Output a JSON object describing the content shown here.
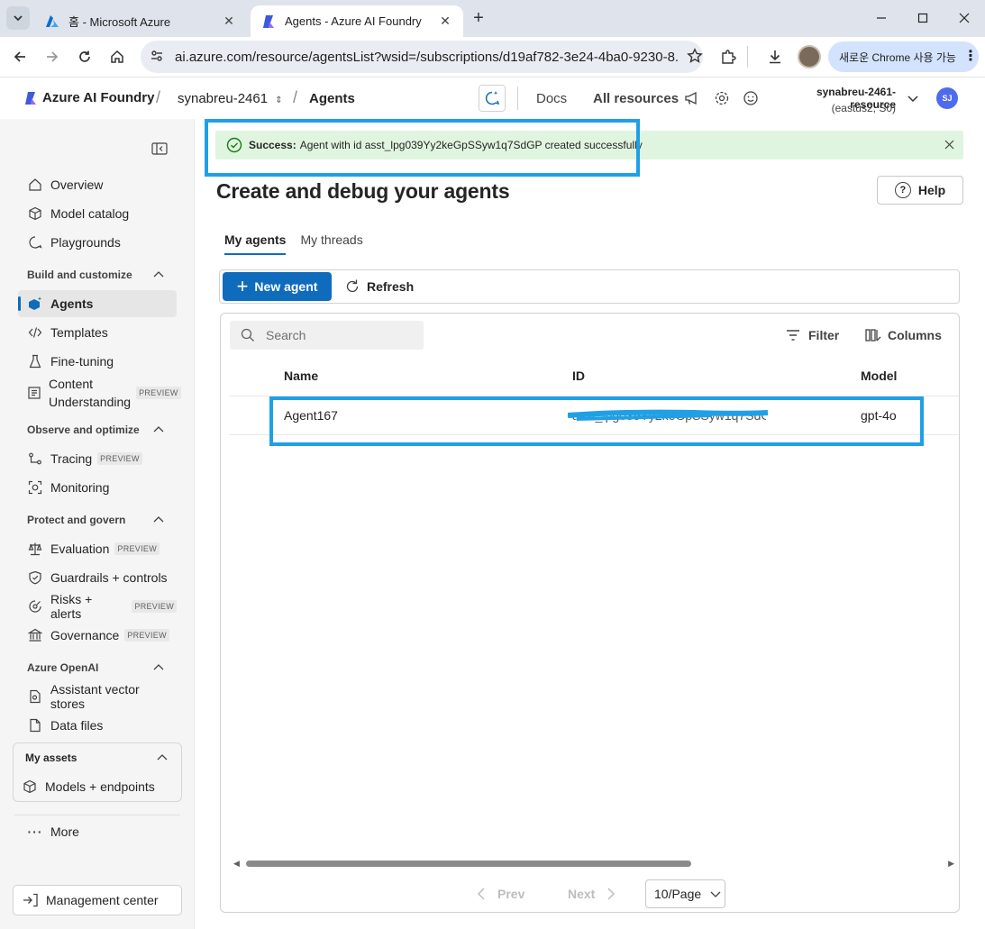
{
  "browser": {
    "tabs": [
      {
        "title": "홈 - Microsoft Azure",
        "active": false
      },
      {
        "title": "Agents - Azure AI Foundry",
        "active": true
      }
    ],
    "url": "ai.azure.com/resource/agentsList?wsid=/subscriptions/d19af782-3e24-4ba0-9230-8...",
    "chrome_available": "새로운 Chrome 사용 가능"
  },
  "header": {
    "brand": "Azure AI Foundry",
    "project": "synabreu-2461",
    "page": "Agents",
    "docs": "Docs",
    "all_resources": "All resources",
    "resource_name": "synabreu-2461-resource",
    "resource_sub": "(eastus2, S0)",
    "avatar_initials": "SJ"
  },
  "sidebar": {
    "top_items": [
      "Overview",
      "Model catalog",
      "Playgrounds"
    ],
    "sections": {
      "build": "Build and customize",
      "observe": "Observe and optimize",
      "protect": "Protect and govern",
      "openai": "Azure OpenAI",
      "assets": "My assets"
    },
    "build_items": [
      "Agents",
      "Templates",
      "Fine-tuning"
    ],
    "content_understanding": [
      "Content",
      "Understanding"
    ],
    "observe_items": [
      "Tracing",
      "Monitoring"
    ],
    "protect_items": [
      "Evaluation",
      "Guardrails + controls",
      "Risks + alerts",
      "Governance"
    ],
    "openai_items": [
      "Assistant vector stores",
      "Data files"
    ],
    "assets_items": [
      "Models + endpoints"
    ],
    "preview_badge": "PREVIEW",
    "more": "More",
    "management_center": "Management center"
  },
  "notification": {
    "label": "Success:",
    "message": "Agent with id asst_lpg039Yy2keGpSSyw1q7SdGP created successfully"
  },
  "main": {
    "title": "Create and debug your agents",
    "help": "Help",
    "tabs": [
      "My agents",
      "My threads"
    ],
    "new_agent": "New agent",
    "refresh": "Refresh",
    "search_placeholder": "Search",
    "filter": "Filter",
    "columns": "Columns",
    "table": {
      "headers": [
        "Name",
        "ID",
        "Model"
      ],
      "rows": [
        {
          "name": "Agent167",
          "id": "asst_lpg039Yy2keGpSSyw1q7SdGP",
          "model": "gpt-4o"
        }
      ]
    },
    "pager": {
      "prev": "Prev",
      "next": "Next",
      "page_size": "10/Page"
    }
  },
  "colors": {
    "accent": "#0f6cbd",
    "success_bg": "#e0f5df",
    "highlight": "#1fa0e6"
  }
}
